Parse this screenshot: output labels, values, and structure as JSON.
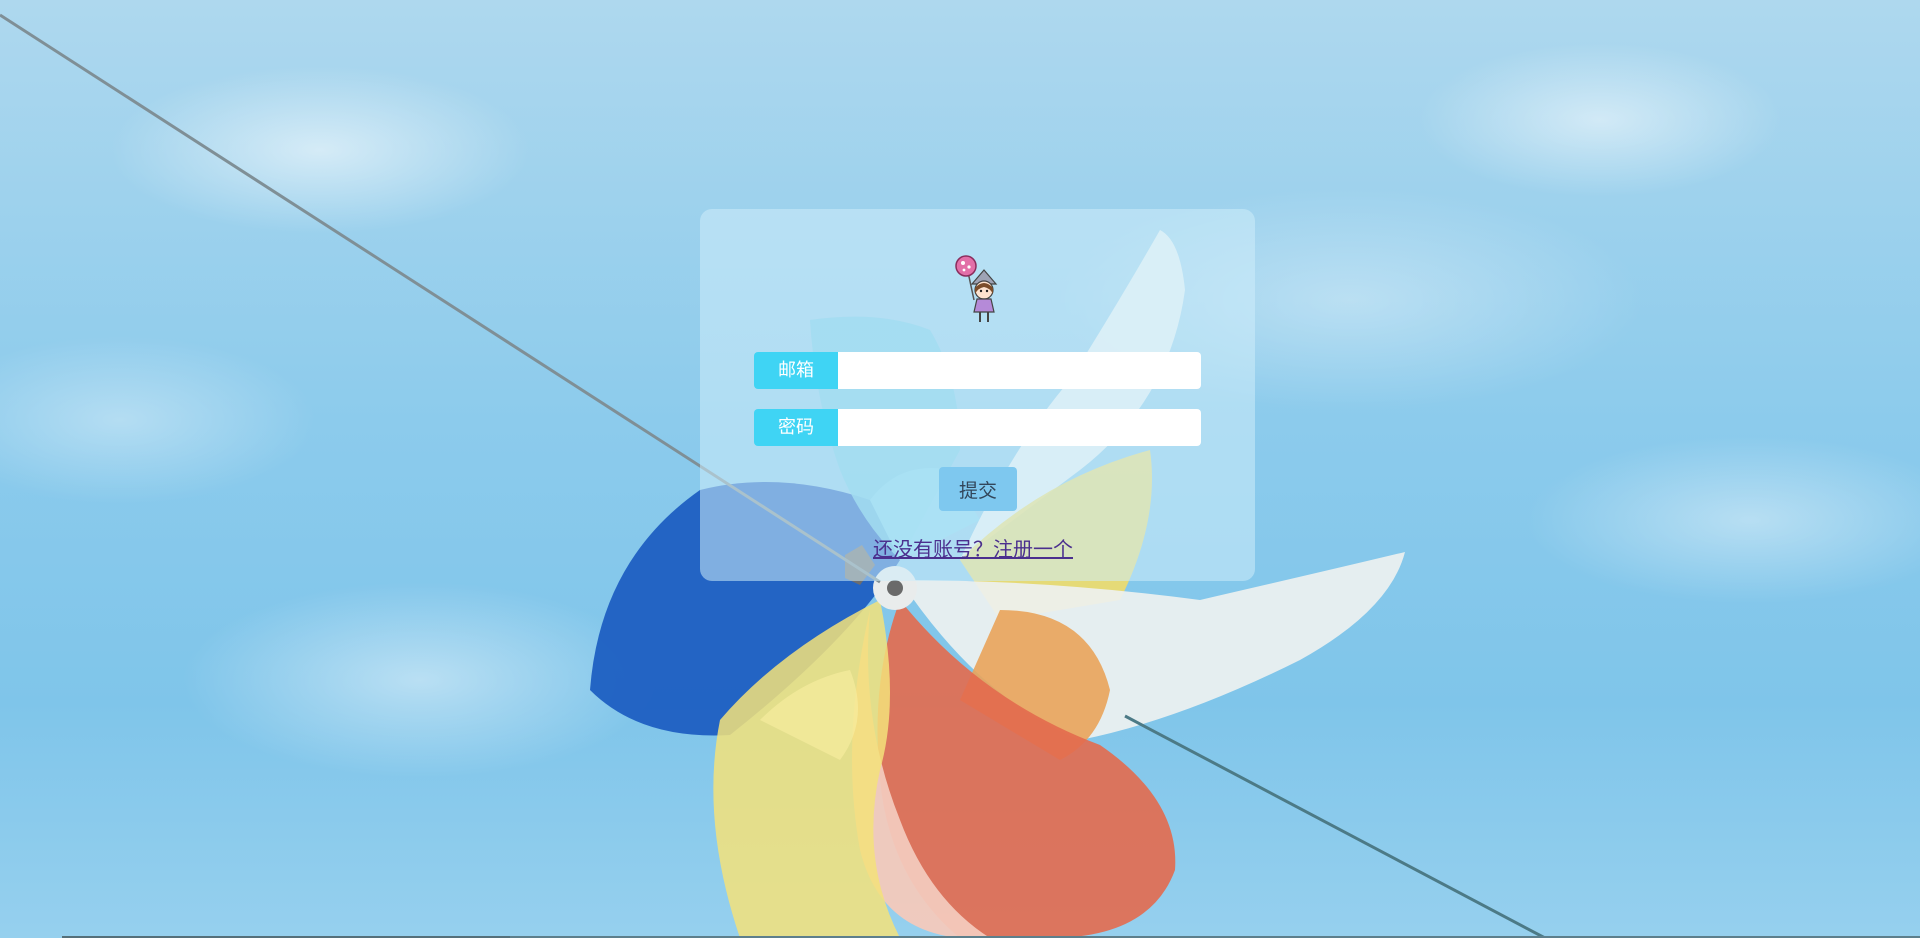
{
  "login": {
    "email_label": "邮箱",
    "email_value": "",
    "password_label": "密码",
    "password_value": "",
    "submit_label": "提交",
    "register_link": "还没有账号？注册一个"
  },
  "colors": {
    "label_bg": "#3fd4f4",
    "submit_bg": "#7ec8ef",
    "link": "#4b2f8e",
    "panel_bg": "rgba(205,236,250,0.55)"
  },
  "icons": {
    "avatar": "cartoon-girl-with-balloon-icon"
  }
}
